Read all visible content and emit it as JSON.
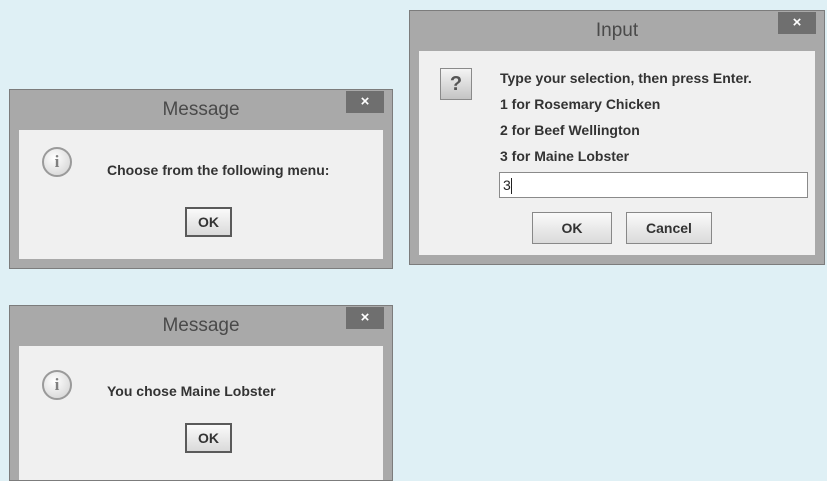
{
  "colors": {
    "background": "#dff0f5",
    "frame": "#a9a9a9",
    "close_button": "#6f6f6f",
    "content": "#f0f0f0"
  },
  "dialog_menu": {
    "title": "Message",
    "close_glyph": "×",
    "icon": "info-icon",
    "icon_glyph": "i",
    "message": "Choose from the following menu:",
    "ok_label": "OK"
  },
  "dialog_input": {
    "title": "Input",
    "close_glyph": "×",
    "icon": "question-icon",
    "icon_glyph": "?",
    "lines": [
      "Type your selection, then press Enter.",
      "1 for Rosemary Chicken",
      "2 for Beef Wellington",
      "3 for Maine Lobster"
    ],
    "input_value": "3",
    "ok_label": "OK",
    "cancel_label": "Cancel"
  },
  "dialog_result": {
    "title": "Message",
    "close_glyph": "×",
    "icon": "info-icon",
    "icon_glyph": "i",
    "message": "You chose Maine Lobster",
    "ok_label": "OK"
  }
}
